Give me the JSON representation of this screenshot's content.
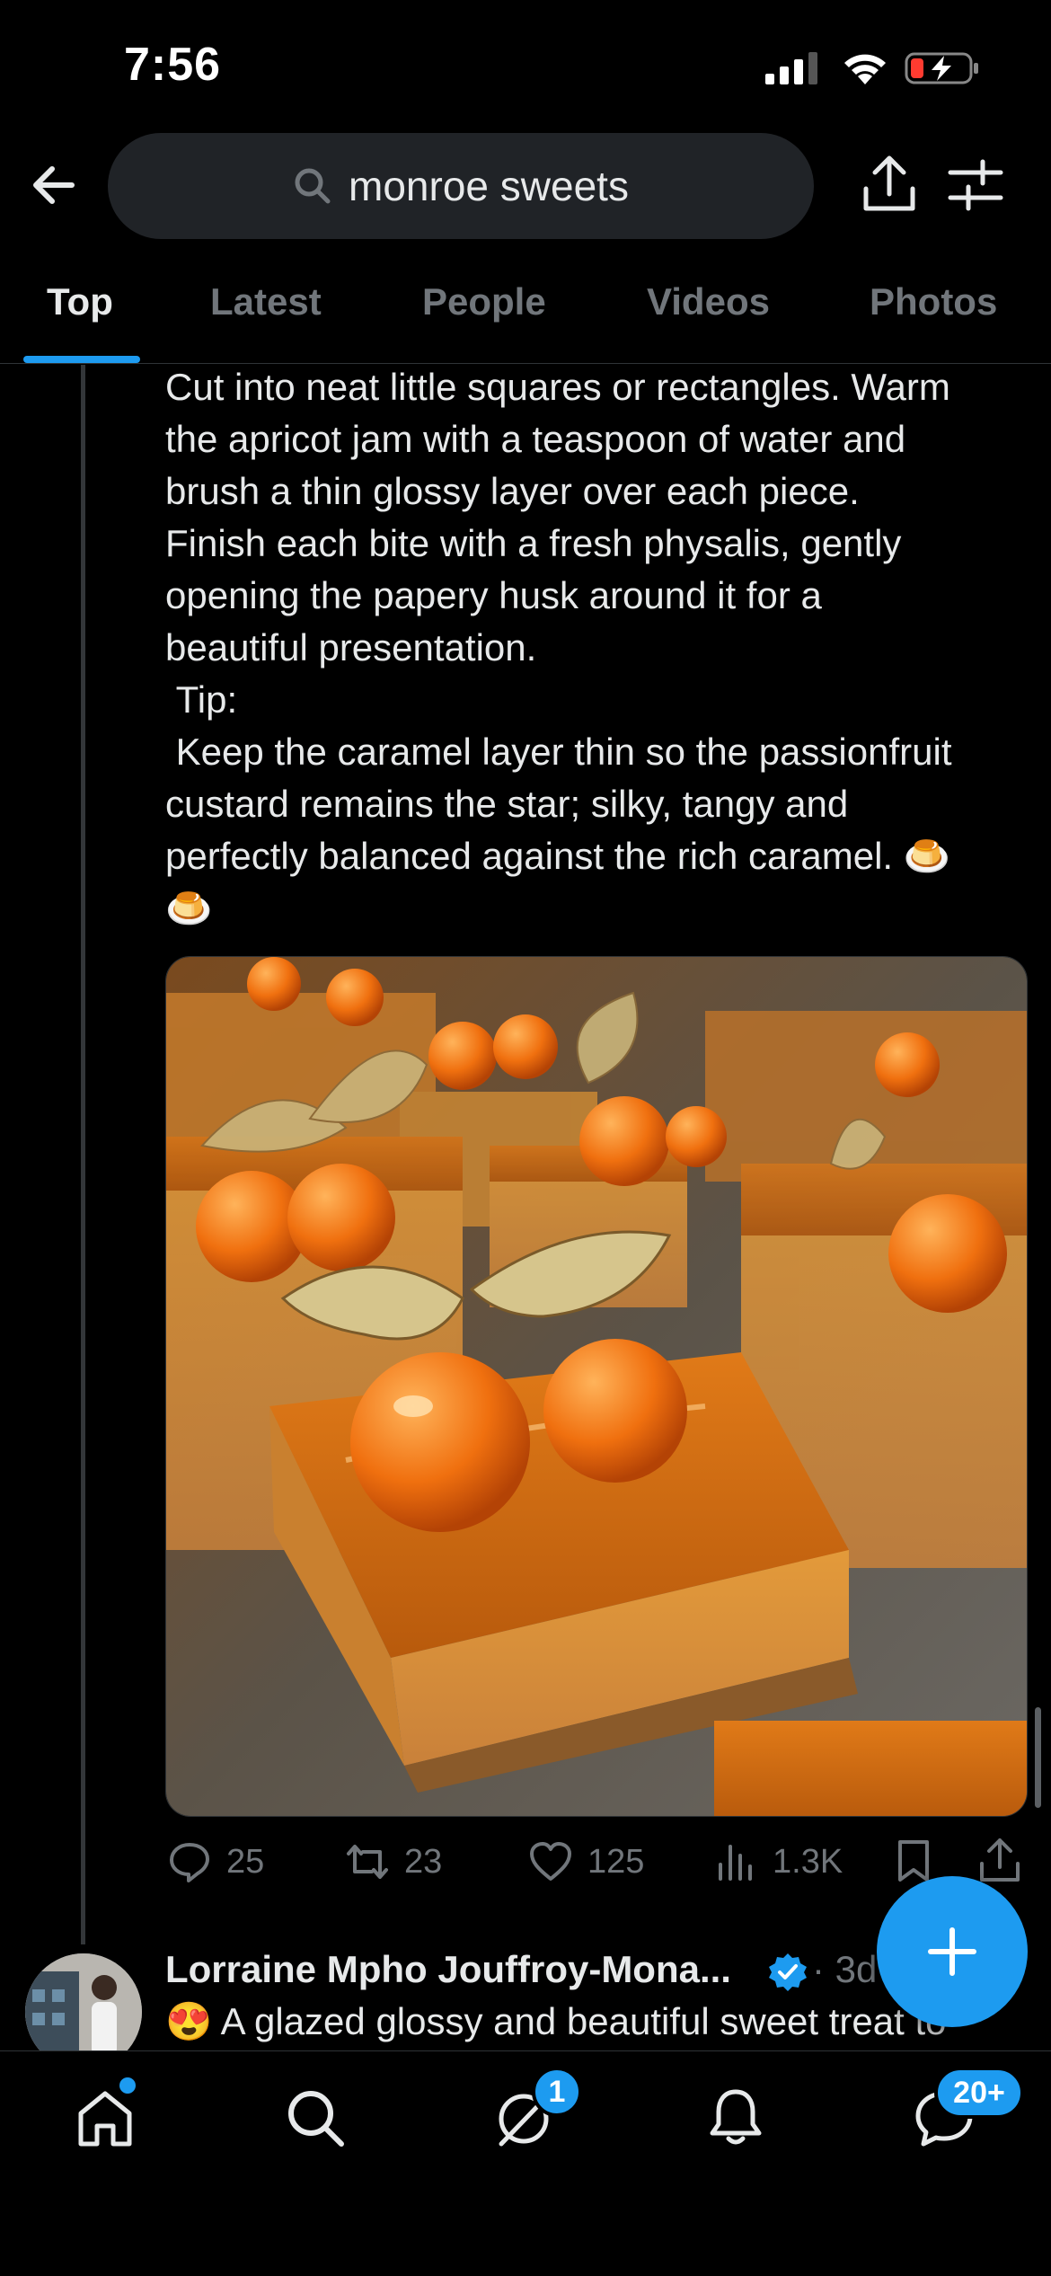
{
  "status_bar": {
    "time": "7:56"
  },
  "header": {
    "search_query": "monroe sweets"
  },
  "tabs": [
    {
      "label": "Top",
      "active": true
    },
    {
      "label": "Latest",
      "active": false
    },
    {
      "label": "People",
      "active": false
    },
    {
      "label": "Videos",
      "active": false
    },
    {
      "label": "Photos",
      "active": false
    }
  ],
  "tweet": {
    "text_lines": [
      "Cut into neat little squares or rectangles. Warm",
      "the apricot jam with a teaspoon of water and",
      "brush a thin glossy layer over each piece.",
      "Finish each bite with a fresh physalis, gently",
      "opening the papery husk around it for a",
      "beautiful presentation.",
      " Tip:",
      " Keep the caramel layer thin so the passionfruit",
      "custard remains the star; silky, tangy and",
      "perfectly balanced against the rich caramel. 🍮",
      "🍮"
    ],
    "stats": {
      "replies": "25",
      "reposts": "23",
      "likes": "125",
      "views": "1.3K"
    }
  },
  "next_tweet": {
    "author": "Lorraine Mpho Jouffroy-Mona...",
    "time": "· 3d",
    "text": "😍 A glazed glossy and beautiful sweet treat to"
  },
  "bottom_nav": {
    "messages_badge": "1",
    "chat_badge": "20+"
  },
  "colors": {
    "accent": "#1d9bf0",
    "background": "#000000",
    "muted": "#71767b"
  }
}
